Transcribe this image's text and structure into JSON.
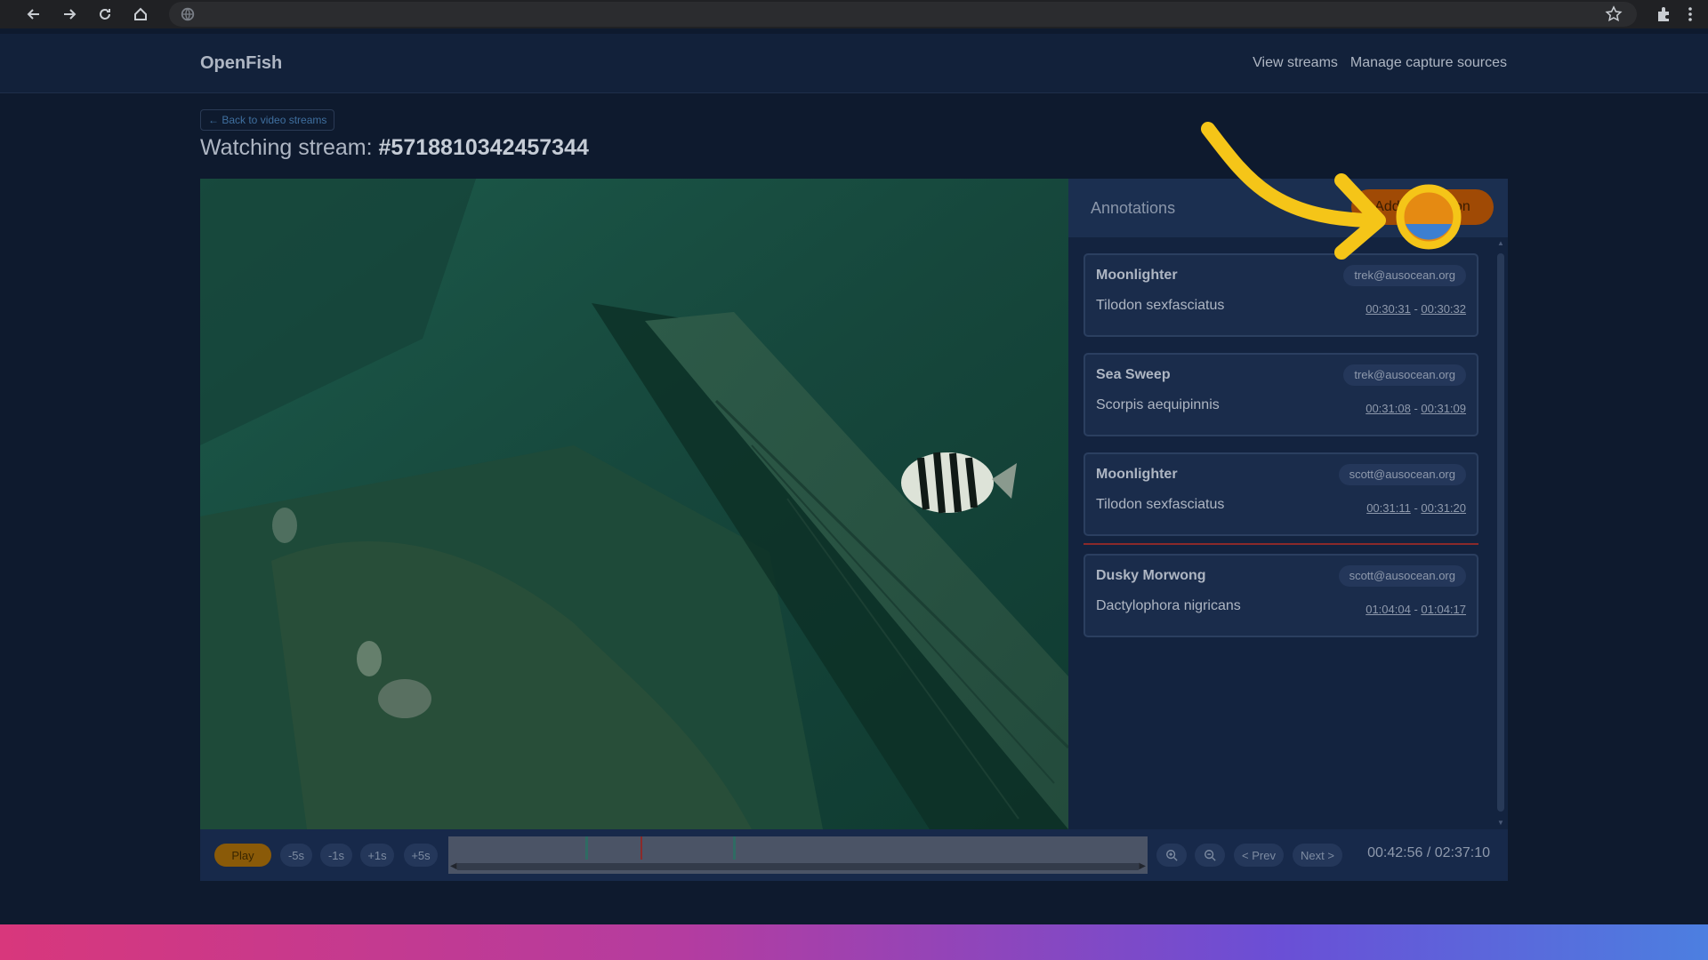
{
  "browser": {
    "icons": [
      "back-icon",
      "forward-icon",
      "reload-icon",
      "home-icon",
      "site-info-icon",
      "bookmark-star-icon",
      "extensions-icon",
      "menu-icon"
    ]
  },
  "header": {
    "brand": "OpenFish",
    "nav": [
      "View streams",
      "Manage capture sources"
    ]
  },
  "page": {
    "back_link": "← Back to video streams",
    "title_prefix": "Watching stream: ",
    "stream_id": "#5718810342457344"
  },
  "annotations": {
    "title": "Annotations",
    "add_button": "Add annotation",
    "items": [
      {
        "name": "Moonlighter",
        "species": "Tilodon sexfasciatus",
        "email": "trek@ausocean.org",
        "start": "00:30:31",
        "end": "00:30:32"
      },
      {
        "name": "Sea Sweep",
        "species": "Scorpis aequipinnis",
        "email": "trek@ausocean.org",
        "start": "00:31:08",
        "end": "00:31:09"
      },
      {
        "name": "Moonlighter",
        "species": "Tilodon sexfasciatus",
        "email": "scott@ausocean.org",
        "start": "00:31:11",
        "end": "00:31:20"
      },
      {
        "name": "Dusky Morwong",
        "species": "Dactylophora nigricans",
        "email": "scott@ausocean.org",
        "start": "01:04:04",
        "end": "01:04:17"
      }
    ],
    "time_separator": " - "
  },
  "controls": {
    "play": "Play",
    "minus5": "-5s",
    "minus1": "-1s",
    "plus1": "+1s",
    "plus5": "+5s",
    "prev": "< Prev",
    "next": "Next >",
    "time": "00:42:56 / 02:37:10"
  },
  "colors": {
    "accent": "#a04a05",
    "tutorial_arrow": "#f5c518",
    "highlight_ring": "#f5c518"
  }
}
